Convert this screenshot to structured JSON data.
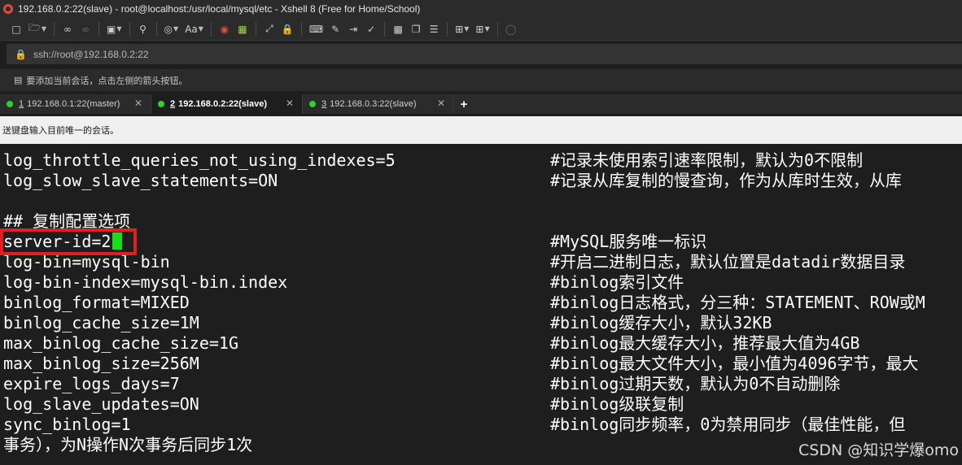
{
  "window": {
    "title": "192.168.0.2:22(slave) - root@localhost:/usr/local/mysql/etc - Xshell 8 (Free for Home/School)"
  },
  "address_bar": {
    "value": "ssh://root@192.168.0.2:22"
  },
  "info_bar": {
    "text": "要添加当前会话，点击左侧的箭头按钮。"
  },
  "tabs": [
    {
      "num": "1",
      "label": "192.168.0.1:22(master)",
      "active": false
    },
    {
      "num": "2",
      "label": "192.168.0.2:22(slave)",
      "active": true
    },
    {
      "num": "3",
      "label": "192.168.0.3:22(slave)",
      "active": false
    }
  ],
  "compose_bar": {
    "text": "送键盘输入目前唯一的会话。"
  },
  "terminal": {
    "lines": [
      {
        "cfg": "log_throttle_queries_not_using_indexes=5",
        "cmt": "#记录未使用索引速率限制，默认为0不限制"
      },
      {
        "cfg": "log_slow_slave_statements=ON",
        "cmt": "#记录从库复制的慢查询，作为从库时生效，从库"
      },
      {
        "cfg": "",
        "cmt": ""
      },
      {
        "cfg": "## 复制配置选项",
        "cmt": ""
      },
      {
        "cfg": "server-id=2",
        "cmt": "#MySQL服务唯一标识"
      },
      {
        "cfg": "log-bin=mysql-bin",
        "cmt": "#开启二进制日志，默认位置是datadir数据目录"
      },
      {
        "cfg": "log-bin-index=mysql-bin.index",
        "cmt": "#binlog索引文件"
      },
      {
        "cfg": "binlog_format=MIXED",
        "cmt": "#binlog日志格式，分三种：STATEMENT、ROW或M"
      },
      {
        "cfg": "binlog_cache_size=1M",
        "cmt": "#binlog缓存大小，默认32KB"
      },
      {
        "cfg": "max_binlog_cache_size=1G",
        "cmt": "#binlog最大缓存大小，推荐最大值为4GB"
      },
      {
        "cfg": "max_binlog_size=256M",
        "cmt": "#binlog最大文件大小，最小值为4096字节，最大"
      },
      {
        "cfg": "expire_logs_days=7",
        "cmt": "#binlog过期天数，默认为0不自动删除"
      },
      {
        "cfg": "log_slave_updates=ON",
        "cmt": "#binlog级联复制"
      },
      {
        "cfg": "sync_binlog=1",
        "cmt": "#binlog同步频率，0为禁用同步（最佳性能，但"
      },
      {
        "cfg": "事务），为N操作N次事务后同步1次",
        "cmt": ""
      }
    ]
  },
  "watermark": "CSDN @知识学爆omo"
}
